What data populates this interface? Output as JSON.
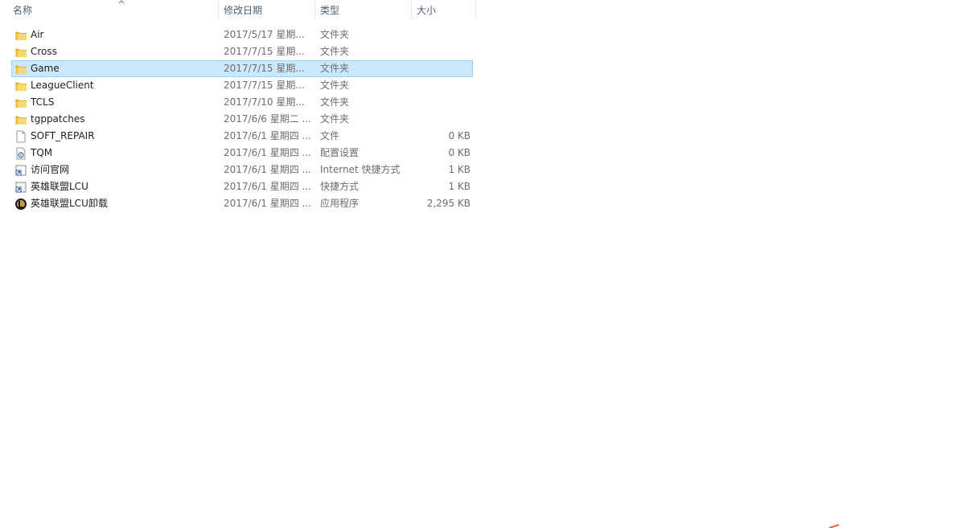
{
  "columns": {
    "name": "名称",
    "date": "修改日期",
    "type": "类型",
    "size": "大小"
  },
  "files": [
    {
      "name": "Air",
      "date": "2017/5/17 星期...",
      "type": "文件夹",
      "size": "",
      "icon": "folder-icon"
    },
    {
      "name": "Cross",
      "date": "2017/7/15 星期...",
      "type": "文件夹",
      "size": "",
      "icon": "folder-icon"
    },
    {
      "name": "Game",
      "date": "2017/7/15 星期...",
      "type": "文件夹",
      "size": "",
      "icon": "folder-icon",
      "selected": true
    },
    {
      "name": "LeagueClient",
      "date": "2017/7/15 星期...",
      "type": "文件夹",
      "size": "",
      "icon": "folder-icon"
    },
    {
      "name": "TCLS",
      "date": "2017/7/10 星期...",
      "type": "文件夹",
      "size": "",
      "icon": "folder-icon"
    },
    {
      "name": "tgppatches",
      "date": "2017/6/6 星期二 ...",
      "type": "文件夹",
      "size": "",
      "icon": "folder-icon"
    },
    {
      "name": "SOFT_REPAIR",
      "date": "2017/6/1 星期四 ...",
      "type": "文件",
      "size": "0 KB",
      "icon": "file-icon"
    },
    {
      "name": "TQM",
      "date": "2017/6/1 星期四 ...",
      "type": "配置设置",
      "size": "0 KB",
      "icon": "config-file-icon"
    },
    {
      "name": "访问官网",
      "date": "2017/6/1 星期四 ...",
      "type": "Internet 快捷方式",
      "size": "1 KB",
      "icon": "internet-shortcut-icon"
    },
    {
      "name": "英雄联盟LCU",
      "date": "2017/6/1 星期四 ...",
      "type": "快捷方式",
      "size": "1 KB",
      "icon": "shortcut-icon"
    },
    {
      "name": "英雄联盟LCU卸载",
      "date": "2017/6/1 星期四 ...",
      "type": "应用程序",
      "size": "2,295 KB",
      "icon": "app-icon"
    }
  ],
  "colors": {
    "selected_bg": "#cce8ff",
    "selected_border": "#99d1ff",
    "header_text": "#4c607a",
    "folder": "#f8d775"
  }
}
